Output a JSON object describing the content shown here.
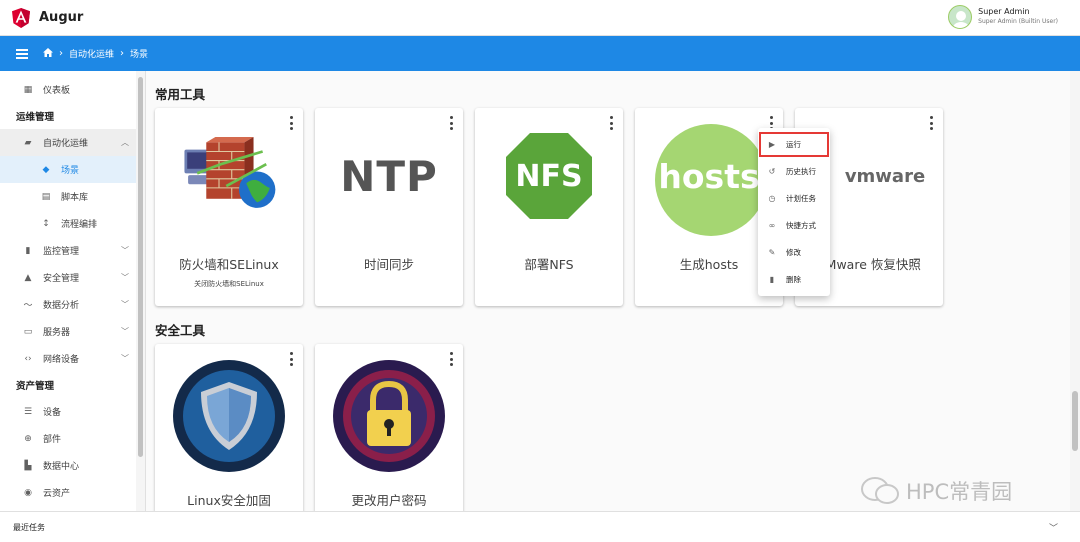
{
  "app": {
    "title": "Augur"
  },
  "user": {
    "name": "Super Admin",
    "role": "Super Admin (Builtin User)"
  },
  "breadcrumb": [
    "自动化运维",
    "场景"
  ],
  "sidebar": {
    "dashboard": "仪表板",
    "section_ops": "运维管理",
    "automation": "自动化运维",
    "scenes": "场景",
    "scripts": "脚本库",
    "flows": "流程编排",
    "monitor": "监控管理",
    "security": "安全管理",
    "analytics": "数据分析",
    "servers": "服务器",
    "network": "网络设备",
    "section_assets": "资产管理",
    "devices": "设备",
    "parts": "部件",
    "datacenter": "数据中心",
    "cloud": "云资产"
  },
  "sections": {
    "common": "常用工具",
    "security": "安全工具"
  },
  "cards": {
    "firewall": {
      "title": "防火墙和SELinux",
      "subtitle": "关闭防火墙和SELinux"
    },
    "ntp": {
      "title": "时间同步",
      "logo": "NTP"
    },
    "nfs": {
      "title": "部署NFS",
      "logo": "NFS"
    },
    "hosts": {
      "title": "生成hosts",
      "logo": "hosts"
    },
    "vmware": {
      "title": "VMware 恢复快照",
      "logo": "vmware"
    },
    "linux": {
      "title": "Linux安全加固"
    },
    "password": {
      "title": "更改用户密码"
    }
  },
  "context_menu": {
    "run": "运行",
    "history": "历史执行",
    "schedule": "计划任务",
    "shortcut": "快捷方式",
    "edit": "修改",
    "delete": "删除"
  },
  "bottombar": {
    "label": "最近任务"
  },
  "watermark": "HPC常青园",
  "colors": {
    "primary": "#1e88e5",
    "accent_red": "#e53935",
    "nfs_green": "#5aa53a",
    "hosts_green": "#a5d672"
  }
}
